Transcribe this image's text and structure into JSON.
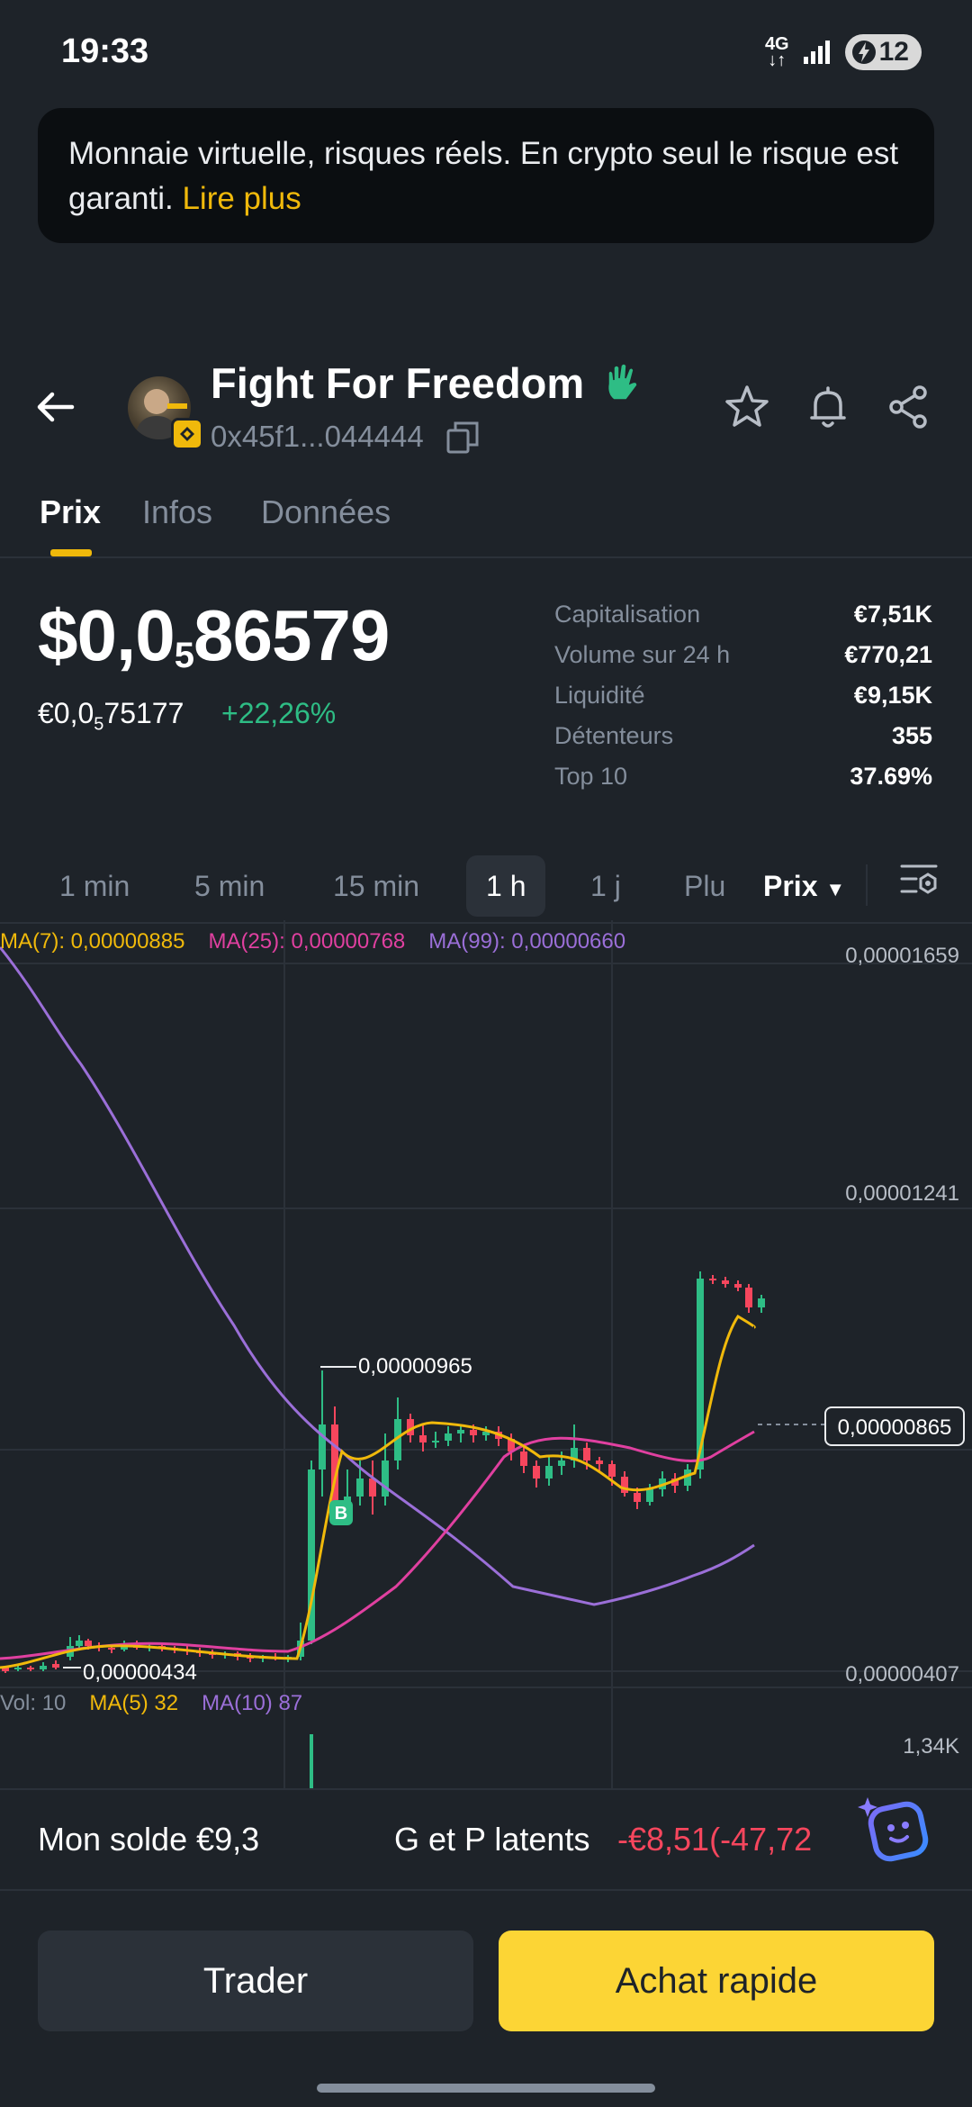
{
  "status_bar": {
    "time": "19:33",
    "network": "4G",
    "battery": "12"
  },
  "banner": {
    "text": "Monnaie virtuelle, risques réels. En crypto seul le risque est garanti. ",
    "link": "Lire plus"
  },
  "token": {
    "name": "Fight For Freedom",
    "address": "0x45f1...044444"
  },
  "tabs": [
    {
      "label": "Prix",
      "active": true
    },
    {
      "label": "Infos",
      "active": false
    },
    {
      "label": "Données",
      "active": false
    }
  ],
  "price": {
    "main_prefix": "$0,0",
    "main_sub": "5",
    "main_suffix": "86579",
    "eur_prefix": "€0,0",
    "eur_sub": "5",
    "eur_suffix": "75177",
    "change": "+22,26%"
  },
  "stats": [
    {
      "label": "Capitalisation",
      "value": "€7,51K"
    },
    {
      "label": "Volume sur 24 h",
      "value": "€770,21"
    },
    {
      "label": "Liquidité",
      "value": "€9,15K"
    },
    {
      "label": "Détenteurs",
      "value": "355"
    },
    {
      "label": "Top 10",
      "value": "37.69%"
    }
  ],
  "timeframes": [
    "1 min",
    "5 min",
    "15 min",
    "1 h",
    "1 j",
    "Plu"
  ],
  "timeframe_active": "1 h",
  "price_select": "Prix",
  "chart": {
    "ma_legend": {
      "ma7": "MA(7): 0,00000885",
      "ma25": "MA(25): 0,00000768",
      "ma99": "MA(99): 0,00000660"
    },
    "vol_legend": {
      "vol": "Vol: 10",
      "ma5": "MA(5) 32",
      "ma10": "MA(10) 87"
    },
    "y_axis": [
      "0,00001659",
      "0,00001241",
      "0,00000407"
    ],
    "vol_axis": "1,34K",
    "high_label": "0,00000965",
    "low_label": "0,00000434",
    "current_price": "0,00000865",
    "colors": {
      "up": "#2ebd85",
      "down": "#f6465d",
      "ma7": "#f0b90b",
      "ma25": "#e040a0",
      "ma99": "#9b6fd8"
    }
  },
  "bottom": {
    "solde": "Mon solde €9,3",
    "pnl_label": "G et P latents",
    "pnl_value": "-€8,51(-47,72"
  },
  "buttons": {
    "trade": "Trader",
    "buy": "Achat rapide"
  }
}
